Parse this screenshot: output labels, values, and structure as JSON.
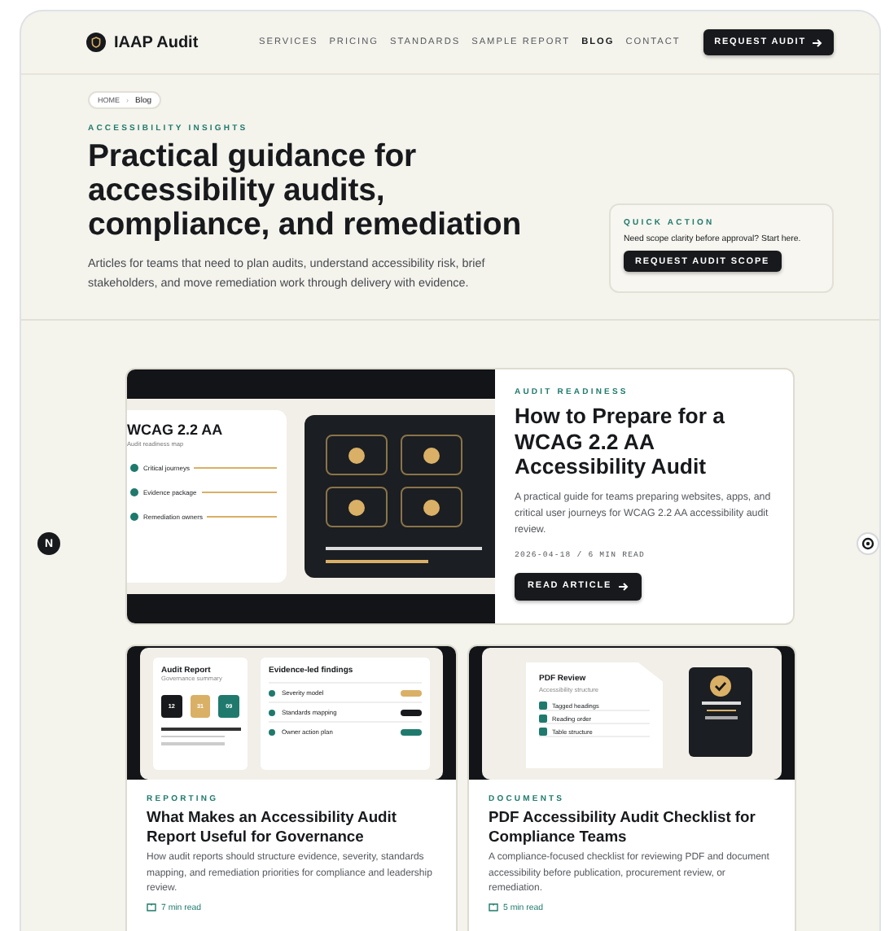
{
  "header": {
    "brand": "IAAP Audit",
    "nav": [
      {
        "label": "SERVICES",
        "selected": false
      },
      {
        "label": "PRICING",
        "selected": false
      },
      {
        "label": "STANDARDS",
        "selected": false
      },
      {
        "label": "SAMPLE REPORT",
        "selected": false
      },
      {
        "label": "BLOG",
        "selected": true
      },
      {
        "label": "CONTACT",
        "selected": false
      }
    ],
    "cta": "REQUEST AUDIT"
  },
  "breadcrumb": {
    "items": [
      "HOME",
      "Blog"
    ],
    "separator": "›"
  },
  "hero": {
    "eyebrow": "ACCESSIBILITY INSIGHTS",
    "title": "Practical guidance for accessibility audits, compliance, and remediation",
    "intro": "Articles for teams that need to plan audits, understand accessibility risk, brief stakeholders, and move remediation work through delivery with evidence.",
    "quick_action": {
      "label": "QUICK ACTION",
      "text": "Need scope clarity before approval? Start here.",
      "button": "REQUEST AUDIT SCOPE"
    }
  },
  "featured": {
    "illustration": {
      "title": "WCAG 2.2 AA",
      "subtitle": "Audit readiness map",
      "steps": [
        "Critical journeys",
        "Evidence package",
        "Remediation owners"
      ]
    },
    "category": "AUDIT READINESS",
    "title": "How to Prepare for a WCAG 2.2 AA Accessibility Audit",
    "summary": "A practical guide for teams preparing websites, apps, and critical user journeys for WCAG 2.2 AA accessibility audit review.",
    "meta": "2026-04-18 / 6 MIN READ",
    "button": "READ ARTICLE"
  },
  "articles": [
    {
      "kind": "report",
      "illustration": {
        "title": "Audit Report",
        "subtitle": "Governance summary",
        "stats": [
          {
            "value": "12",
            "color": "#17191c"
          },
          {
            "value": "31",
            "color": "#d9b066"
          },
          {
            "value": "09",
            "color": "#1f7a6d"
          }
        ],
        "panel_title": "Evidence-led findings",
        "rows": [
          {
            "label": "Severity model",
            "color": "#d9b066"
          },
          {
            "label": "Standards mapping",
            "color": "#17191c"
          },
          {
            "label": "Owner action plan",
            "color": "#1f7a6d"
          }
        ]
      },
      "category": "REPORTING",
      "title": "What Makes an Accessibility Audit Report Useful for Governance",
      "summary": "How audit reports should structure evidence, severity, standards mapping, and remediation priorities for compliance and leadership review.",
      "read_time": "7 min read"
    },
    {
      "kind": "pdf",
      "illustration": {
        "title": "PDF Review",
        "subtitle": "Accessibility structure",
        "items": [
          "Tagged headings",
          "Reading order",
          "Table structure"
        ]
      },
      "category": "DOCUMENTS",
      "title": "PDF Accessibility Audit Checklist for Compliance Teams",
      "summary": "A compliance-focused checklist for reviewing PDF and document accessibility before publication, procurement review, or remediation.",
      "read_time": "5 min read"
    }
  ],
  "dev_badge": "N"
}
